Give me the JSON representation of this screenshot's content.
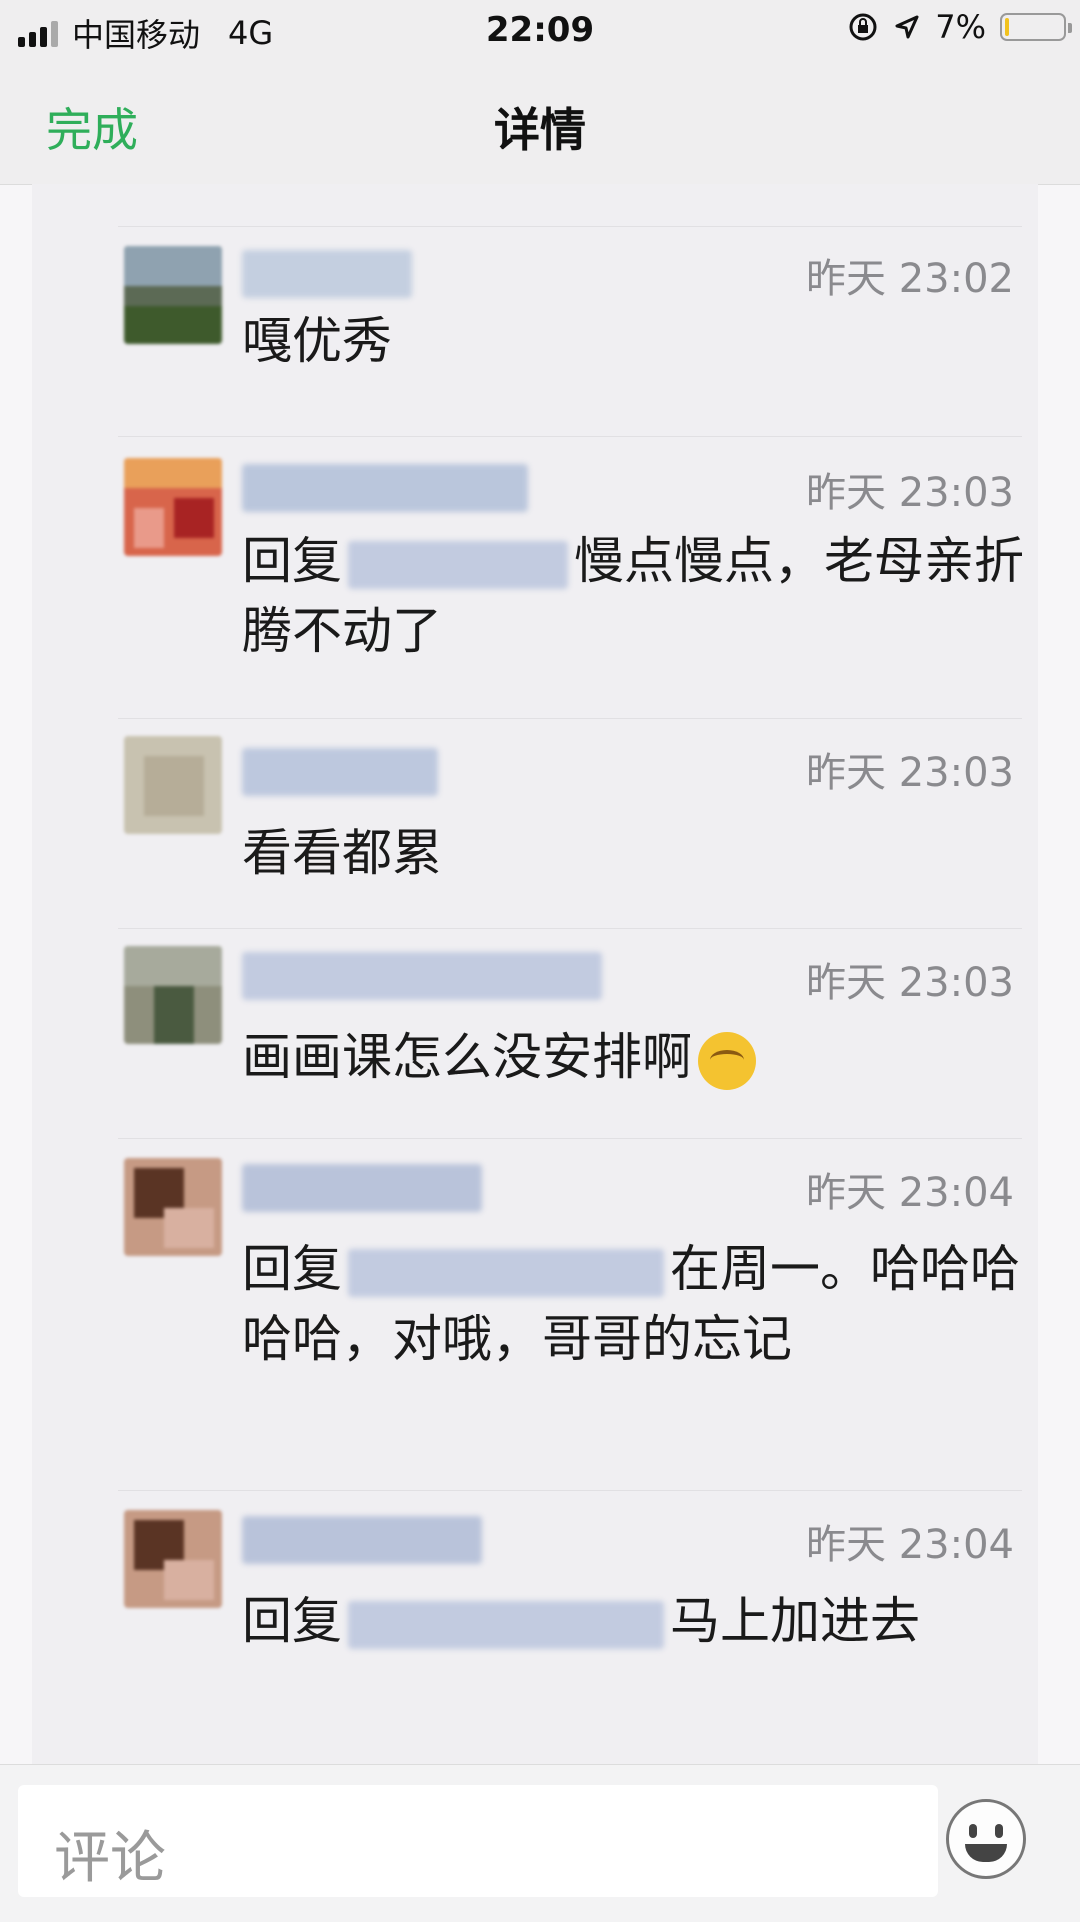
{
  "status_bar": {
    "carrier": "中国移动",
    "network": "4G",
    "time": "22:09",
    "battery_text": "7%",
    "battery_level": 0.07
  },
  "nav": {
    "done_label": "完成",
    "title": "详情"
  },
  "comments": [
    {
      "time": "昨天 23:02",
      "text": "嘎优秀"
    },
    {
      "time": "昨天 23:03",
      "reply_prefix": "回复",
      "text": "慢点慢点，老母亲折腾不动了"
    },
    {
      "time": "昨天 23:03",
      "text": "看看都累"
    },
    {
      "time": "昨天 23:03",
      "text": "画画课怎么没安排啊"
    },
    {
      "time": "昨天 23:04",
      "reply_prefix": "回复",
      "text": "在周一。哈哈哈哈哈，对哦，哥哥的忘记"
    },
    {
      "time": "昨天 23:04",
      "reply_prefix": "回复",
      "text": "马上加进去"
    }
  ],
  "input": {
    "placeholder": "评论"
  },
  "colors": {
    "accent_green": "#2fae5a",
    "timestamp_gray": "#8a8a8e"
  },
  "icons": [
    "signal-icon",
    "rotation-lock-icon",
    "location-arrow-icon",
    "battery-icon",
    "emoji-icon",
    "smiley-face-icon"
  ]
}
